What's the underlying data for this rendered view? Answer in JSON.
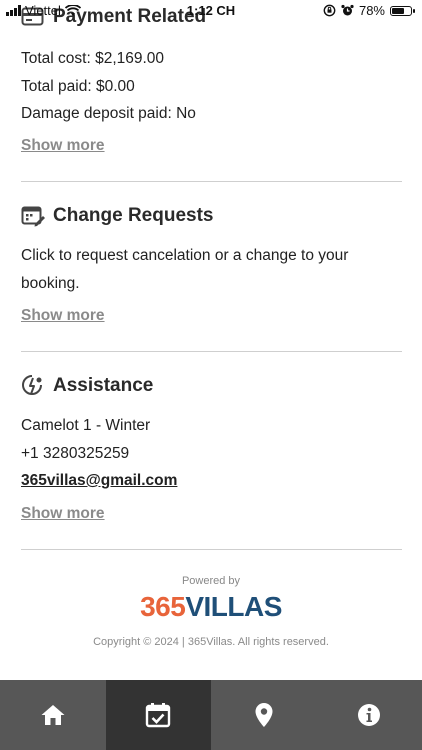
{
  "status_bar": {
    "carrier": "Viettel",
    "time": "1:12 CH",
    "battery": "78%",
    "battery_level": 0.78
  },
  "sections": {
    "payment": {
      "title": "Payment Related",
      "lines": [
        "Total cost: $2,169.00",
        "Total paid: $0.00",
        "Damage deposit paid: No"
      ],
      "show_more": "Show more"
    },
    "change": {
      "title": "Change Requests",
      "text": "Click to request cancelation or a change to your booking.",
      "show_more": "Show more"
    },
    "assistance": {
      "title": "Assistance",
      "name": "Camelot 1 - Winter",
      "phone": "+1 3280325259",
      "email": "365villas@gmail.com",
      "show_more": "Show more"
    }
  },
  "footer": {
    "powered_by": "Powered by",
    "logo_number": "365",
    "logo_text": "VILLAS",
    "copyright": "Copyright © 2024 | 365Villas. All rights reserved."
  },
  "tabbar": {
    "active_index": 1,
    "icons": [
      "home-icon",
      "calendar-check-icon",
      "map-pin-icon",
      "info-icon"
    ]
  }
}
